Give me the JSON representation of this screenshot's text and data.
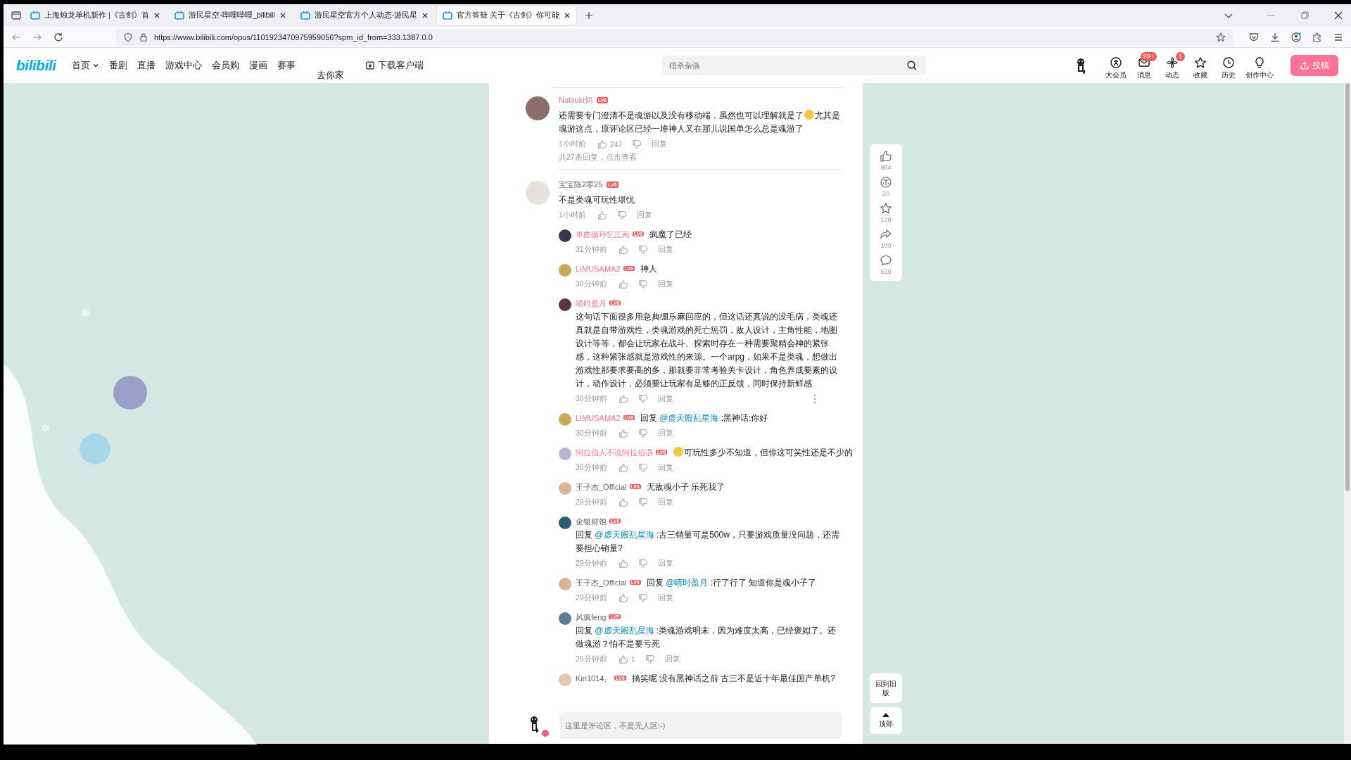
{
  "browser": {
    "tabs": [
      {
        "title": "上海烛龙单机新作 |《古剑》首",
        "selected": false
      },
      {
        "title": "游民星空-哔哩哔哩_bilibili",
        "selected": false
      },
      {
        "title": "游民星空官方个人动态-游民星",
        "selected": false
      },
      {
        "title": "官方答疑 关于《古剑》你可能",
        "selected": true
      }
    ],
    "url": "https://www.bilibili.com/opus/1101923470975959056?spm_id_from=333.1387.0.0"
  },
  "header": {
    "logo": "bilibili",
    "nav": [
      {
        "label": "首页",
        "kind": "dropdown"
      },
      {
        "label": "番剧",
        "kind": "link"
      },
      {
        "label": "直播",
        "kind": "link"
      },
      {
        "label": "游戏中心",
        "kind": "link"
      },
      {
        "label": "会员购",
        "kind": "link"
      },
      {
        "label": "漫画",
        "kind": "link"
      },
      {
        "label": "赛事",
        "kind": "link"
      },
      {
        "label": "去你家",
        "kind": "dropped"
      },
      {
        "label": "下载客户端",
        "kind": "download"
      }
    ],
    "search": {
      "placeholder": "猎杀杂谈"
    },
    "actions": [
      {
        "label": "大会员",
        "kind": "vip"
      },
      {
        "label": "消息",
        "kind": "mail",
        "badge": "99+"
      },
      {
        "label": "动态",
        "kind": "fan",
        "badge": "1"
      },
      {
        "label": "收藏",
        "kind": "star"
      },
      {
        "label": "历史",
        "kind": "clock"
      },
      {
        "label": "创作中心",
        "kind": "bulb"
      }
    ],
    "upload": "投稿"
  },
  "comments": [
    {
      "name": "Natsuki妈",
      "vip": true,
      "level": "LV6",
      "segments": [
        {
          "kind": "text",
          "text": "还需要专门澄清不是魂游以及没有移动端，虽然也可以理解就是了"
        },
        {
          "kind": "emoji"
        },
        {
          "kind": "text",
          "text": "尤其是魂游这点，原评论区已经一堆神人又在那儿说国单怎么总是魂游了"
        }
      ],
      "time": "1小时前",
      "likes": "247",
      "reply": "回复",
      "more": "共27条回复，点击查看"
    },
    {
      "name": "宝宝陈2零25",
      "vip": false,
      "level": "LV6",
      "segments": [
        {
          "kind": "text",
          "text": "不是类魂可玩性堪忧"
        }
      ],
      "time": "1小时前",
      "reply": "回复",
      "replies": [
        {
          "name": "单曲循环忆江南",
          "vip": true,
          "level": "LV6",
          "segments": [
            {
              "kind": "text",
              "text": "疯魔了已经"
            }
          ],
          "time": "31分钟前",
          "reply": "回复"
        },
        {
          "name": "LIMUSAMA2",
          "vip": true,
          "level": "LV6",
          "segments": [
            {
              "kind": "text",
              "text": "神人"
            }
          ],
          "time": "30分钟前",
          "reply": "回复"
        },
        {
          "name": "晴时盈月",
          "vip": true,
          "level": "LV6",
          "segments": [
            {
              "kind": "text",
              "text": "这句话下面很多用急典绷乐麻回应的，但这话还真说的没毛病，类魂还真就是自带游戏性，类魂游戏的死亡惩罚，敌人设计，主角性能，地图设计等等，都会让玩家在战斗、探索时存在一种需要聚精会神的紧张感，这种紧张感就是游戏性的来源。一个arpg，如果不是类魂，想做出游戏性那要求要高的多，那就要非常考验关卡设计，角色养成要素的设计，动作设计，必须要让玩家有足够的正反馈，同时保持新鲜感"
            }
          ],
          "time": "30分钟前",
          "reply": "回复",
          "more_menu": true
        },
        {
          "name": "LIMUSAMA2",
          "vip": true,
          "level": "LV6",
          "segments": [
            {
              "kind": "text",
              "text": "回复 "
            },
            {
              "kind": "mention",
              "text": "@虚天殿乱星海"
            },
            {
              "kind": "text",
              "text": " :黑神话:你好"
            }
          ],
          "time": "30分钟前",
          "reply": "回复"
        },
        {
          "name": "阿拉伯人不说阿拉伯语",
          "vip": true,
          "level": "LV6",
          "segments": [
            {
              "kind": "emoji"
            },
            {
              "kind": "text",
              "text": "可玩性多少不知道，但你这可笑性还是不少的"
            }
          ],
          "time": "30分钟前",
          "reply": "回复"
        },
        {
          "name": "王子杰_Official",
          "vip": false,
          "level": "LV6",
          "segments": [
            {
              "kind": "text",
              "text": "无敌魂小子 乐死我了"
            }
          ],
          "time": "29分钟前",
          "reply": "回复"
        },
        {
          "name": "金银财饱",
          "vip": false,
          "level": "LV6",
          "segments": [
            {
              "kind": "text",
              "text": "回复 "
            },
            {
              "kind": "mention",
              "text": "@虚天殿乱星海"
            },
            {
              "kind": "text",
              "text": " :古三销量可是500w，只要游戏质量没问题，还需要担心销量?"
            }
          ],
          "time": "29分钟前",
          "reply": "回复"
        },
        {
          "name": "王子杰_Official",
          "vip": false,
          "level": "LV6",
          "segments": [
            {
              "kind": "text",
              "text": "回复 "
            },
            {
              "kind": "mention",
              "text": "@晴时盈月"
            },
            {
              "kind": "text",
              "text": " :行了行了 知道你是魂小子了"
            }
          ],
          "time": "28分钟前",
          "reply": "回复"
        },
        {
          "name": "风疯feng",
          "vip": false,
          "level": "LV5",
          "segments": [
            {
              "kind": "text",
              "text": "回复 "
            },
            {
              "kind": "mention",
              "text": "@虚天殿乱星海"
            },
            {
              "kind": "text",
              "text": " :类魂游戏明末，因为难度太高，已经褒姒了。还做魂游？怕不是要亏死"
            }
          ],
          "time": "25分钟前",
          "likes": "1",
          "reply": "回复"
        },
        {
          "name": "Kiri1014、",
          "vip": false,
          "level": "LV6",
          "segments": [
            {
              "kind": "text",
              "text": "搞笑呢 没有黑神话之前 古三不是近十年最佳国产单机?"
            }
          ]
        }
      ]
    }
  ],
  "comment_box": {
    "placeholder": "这里是评论区，不是无人区:-)"
  },
  "side_actions": [
    {
      "kind": "like",
      "count": "884"
    },
    {
      "kind": "coin",
      "count": "20"
    },
    {
      "kind": "star",
      "count": "128"
    },
    {
      "kind": "share",
      "count": "100"
    },
    {
      "kind": "comment",
      "count": "619"
    }
  ],
  "side_buttons": [
    {
      "kind": "old",
      "label": "回到旧版"
    },
    {
      "kind": "top",
      "label": "顶部"
    }
  ]
}
